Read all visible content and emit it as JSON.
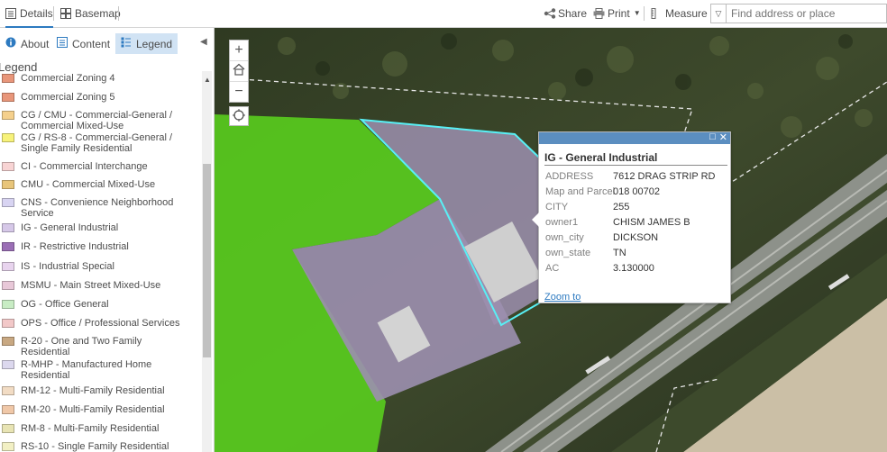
{
  "topbar": {
    "details": "Details",
    "basemap": "Basemap",
    "share": "Share",
    "print": "Print",
    "measure": "Measure",
    "search_placeholder": "Find address or place"
  },
  "panel": {
    "tabs": [
      "About",
      "Content",
      "Legend"
    ],
    "legend_title": "Legend",
    "items": [
      {
        "label": "Commercial Zoning 4",
        "color": "#e8967a"
      },
      {
        "label": "Commercial Zoning 5",
        "color": "#e8967a"
      },
      {
        "label": "CG / CMU - Commercial-General / Commercial Mixed-Use",
        "color": "#f5d08c"
      },
      {
        "label": "CG / RS-8 - Commercial-General / Single Family Residential",
        "color": "#f7f27a"
      },
      {
        "label": "CI - Commercial Interchange",
        "color": "#f8d4d4"
      },
      {
        "label": "CMU - Commercial Mixed-Use",
        "color": "#e8c57a"
      },
      {
        "label": "CNS - Convenience Neighborhood Service",
        "color": "#d8d4f2"
      },
      {
        "label": "IG - General Industrial",
        "color": "#d6c8e8"
      },
      {
        "label": "IR - Restrictive Industrial",
        "color": "#9b6fb6"
      },
      {
        "label": "IS - Industrial Special",
        "color": "#e8d4ee"
      },
      {
        "label": "MSMU - Main Street Mixed-Use",
        "color": "#e8c8d8"
      },
      {
        "label": "OG - Office General",
        "color": "#c8ecc4"
      },
      {
        "label": "OPS - Office / Professional Services",
        "color": "#f2c8c8"
      },
      {
        "label": "R-20 - One and Two Family Residential",
        "color": "#c8a882"
      },
      {
        "label": "R-MHP - Manufactured Home Residential",
        "color": "#dcd8ee"
      },
      {
        "label": "RM-12 - Multi-Family Residential",
        "color": "#f2dcc4"
      },
      {
        "label": "RM-20 - Multi-Family Residential",
        "color": "#f0c8a8"
      },
      {
        "label": "RM-8 - Multi-Family Residential",
        "color": "#e8e4b4"
      },
      {
        "label": "RS-10 - Single Family Residential",
        "color": "#f2f0c4"
      }
    ]
  },
  "popup": {
    "title": "IG - General Industrial",
    "rows": [
      {
        "key": "ADDRESS",
        "value": "7612 DRAG STRIP RD"
      },
      {
        "key": "Map and Parcel",
        "value": "018 00702"
      },
      {
        "key": "CITY",
        "value": "255"
      },
      {
        "key": "owner1",
        "value": "CHISM JAMES B"
      },
      {
        "key": "own_city",
        "value": "DICKSON"
      },
      {
        "key": "own_state",
        "value": "TN"
      },
      {
        "key": "AC",
        "value": "3.130000"
      }
    ],
    "zoom_to": "Zoom to"
  }
}
